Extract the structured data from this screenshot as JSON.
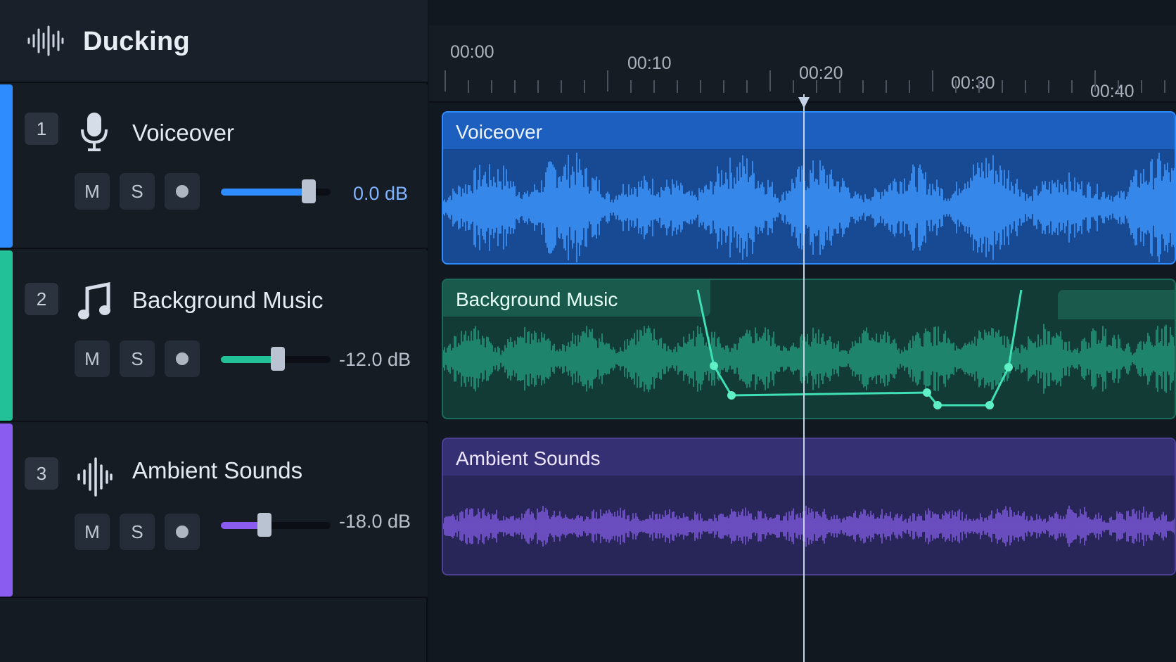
{
  "app": {
    "title": "Ducking"
  },
  "colors": {
    "voiceover": "#2f8cff",
    "music": "#22c197",
    "ambient": "#8a5cf0"
  },
  "ruler": {
    "labels": [
      "00:00",
      "00:10",
      "00:20",
      "00:30",
      "00:40"
    ]
  },
  "tracks": [
    {
      "number": "1",
      "name": "Voiceover",
      "icon": "microphone-icon",
      "mute": "M",
      "solo": "S",
      "volume_db": "0.0 dB",
      "volume_level": 0.8,
      "clip_name": "Voiceover"
    },
    {
      "number": "2",
      "name": "Background Music",
      "icon": "music-note-icon",
      "mute": "M",
      "solo": "S",
      "volume_db": "-12.0 dB",
      "volume_level": 0.52,
      "clip_name": "Background Music"
    },
    {
      "number": "3",
      "name": "Ambient Sounds",
      "icon": "waveform-icon",
      "mute": "M",
      "solo": "S",
      "volume_db": "-18.0 dB",
      "volume_level": 0.4,
      "clip_name": "Ambient Sounds"
    }
  ]
}
